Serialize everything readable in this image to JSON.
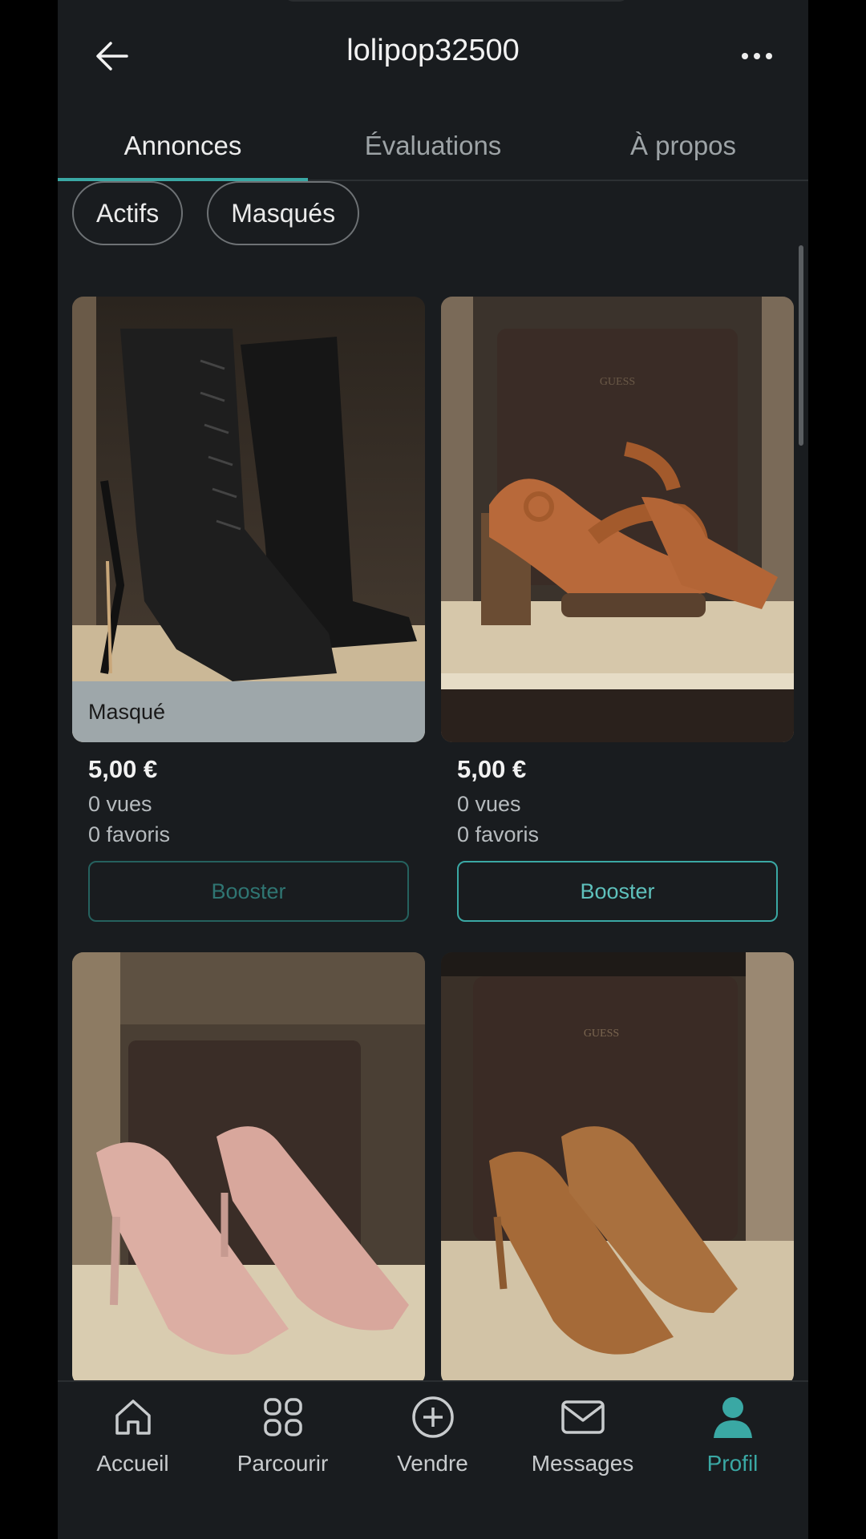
{
  "header": {
    "title": "lolipop32500"
  },
  "tabs": [
    {
      "label": "Annonces",
      "active": true
    },
    {
      "label": "Évaluations",
      "active": false
    },
    {
      "label": "À propos",
      "active": false
    }
  ],
  "chips": [
    "Actifs",
    "Masqués"
  ],
  "items": [
    {
      "badge": "Masqué",
      "price": "5,00 €",
      "views": "0 vues",
      "favorites": "0 favoris",
      "boost_label": "Booster",
      "boost_enabled": false,
      "image": "black-boots-image"
    },
    {
      "badge": "",
      "price": "5,00 €",
      "views": "0 vues",
      "favorites": "0 favoris",
      "boost_label": "Booster",
      "boost_enabled": true,
      "image": "tan-sandals-image"
    },
    {
      "image": "pink-pumps-image"
    },
    {
      "image": "brown-pumps-image"
    }
  ],
  "bottom_nav": [
    {
      "label": "Accueil",
      "icon": "home-icon",
      "active": false
    },
    {
      "label": "Parcourir",
      "icon": "grid-icon",
      "active": false
    },
    {
      "label": "Vendre",
      "icon": "plus-circle-icon",
      "active": false
    },
    {
      "label": "Messages",
      "icon": "mail-icon",
      "active": false
    },
    {
      "label": "Profil",
      "icon": "profile-icon",
      "active": true
    }
  ],
  "colors": {
    "accent": "#3aa8a4",
    "background": "#191c1f"
  }
}
